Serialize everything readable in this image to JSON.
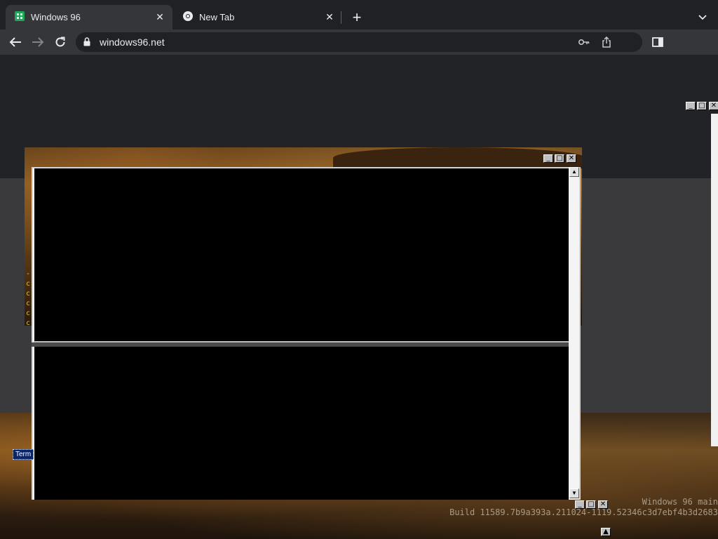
{
  "browser": {
    "tabs": [
      {
        "title": "Windows 96",
        "active": true,
        "icon": "windows96-favicon"
      },
      {
        "title": "New Tab",
        "active": false,
        "icon": "chrome-icon"
      }
    ],
    "url": "windows96.net",
    "accent": "#35363a"
  },
  "page": {
    "desktop_icon_label": "Term",
    "watermark": {
      "line1": "Windows 96 main",
      "line2": "Build 11589.7b9a393a.211024-1119.52346c3d7ebf4b3d2683"
    },
    "terminal_yellow_chars": [
      "-",
      "c",
      "c",
      "c",
      "c",
      "c"
    ]
  }
}
